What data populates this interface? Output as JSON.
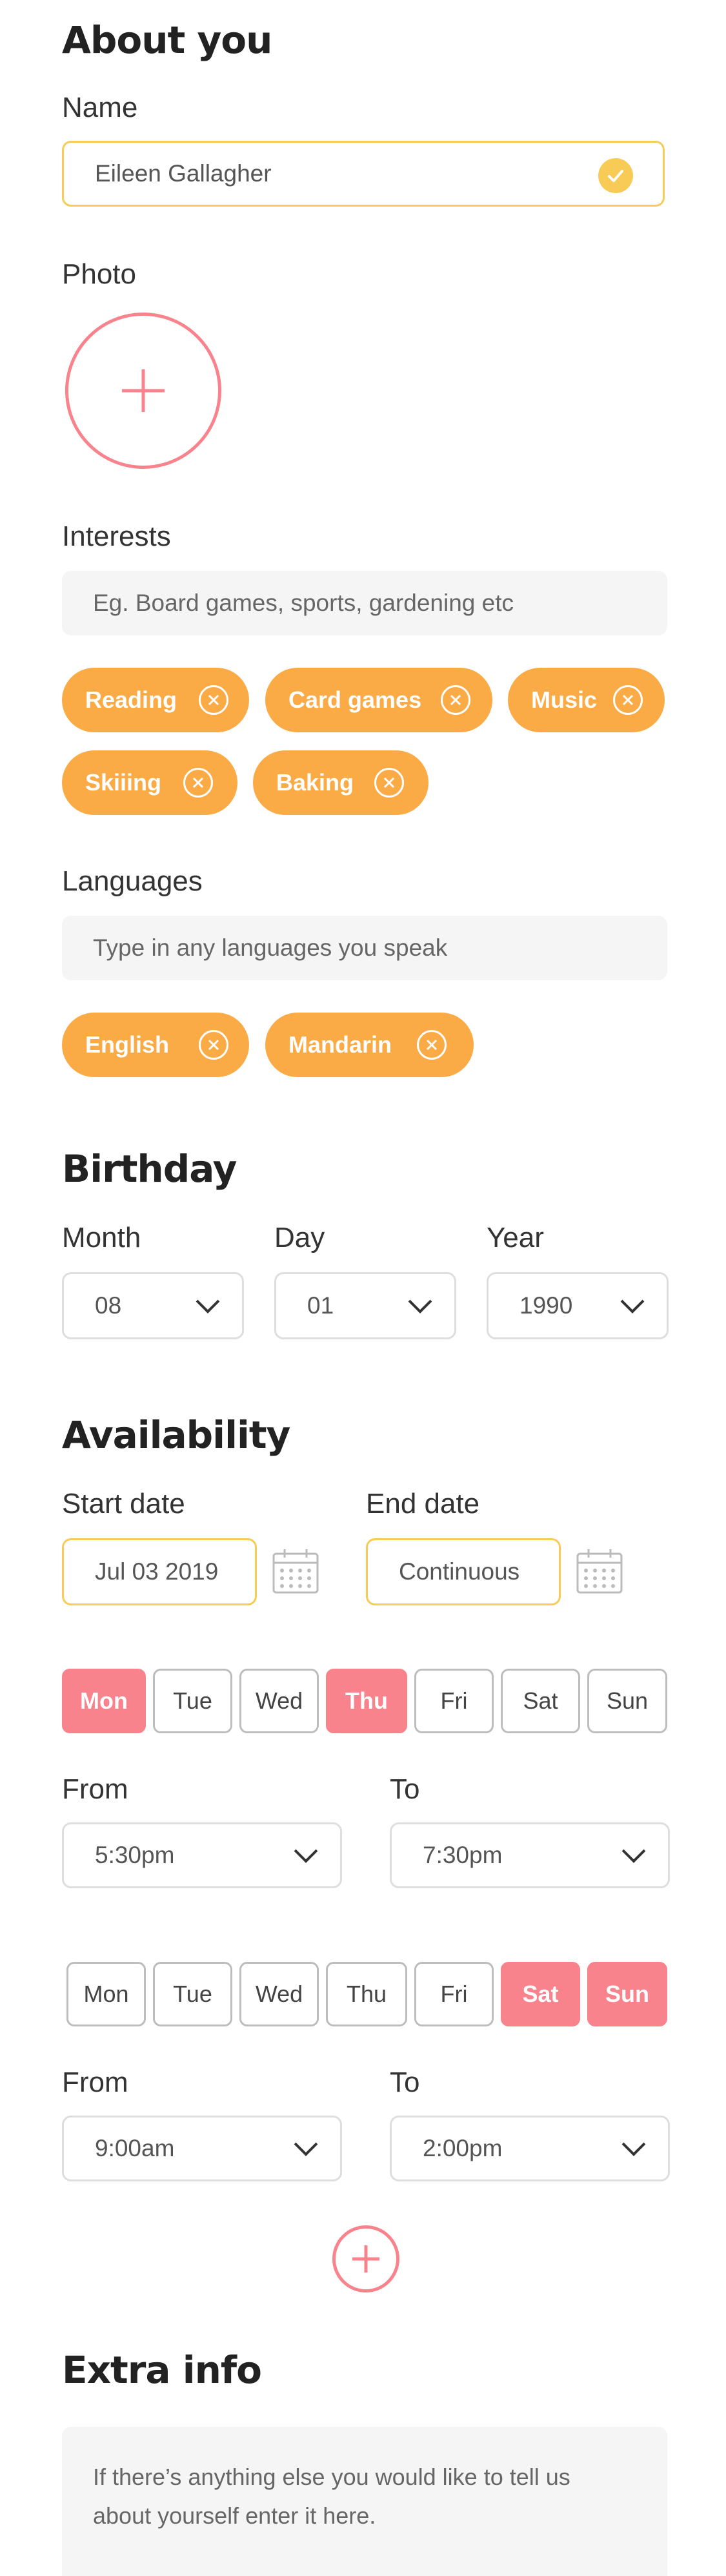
{
  "about": {
    "title": "About you",
    "name_label": "Name",
    "name_value": "Eileen Gallagher",
    "photo_label": "Photo",
    "interests_label": "Interests",
    "interests_placeholder": "Eg. Board games, sports, gardening etc",
    "interests": [
      "Reading",
      "Card games",
      "Music",
      "Skiiing",
      "Baking"
    ],
    "languages_label": "Languages",
    "languages_placeholder": "Type in any languages you speak",
    "languages": [
      "English",
      "Mandarin"
    ]
  },
  "birthday": {
    "title": "Birthday",
    "month_label": "Month",
    "month_value": "08",
    "day_label": "Day",
    "day_value": "01",
    "year_label": "Year",
    "year_value": "1990"
  },
  "availability": {
    "title": "Availability",
    "start_label": "Start date",
    "start_value": "Jul 03 2019",
    "end_label": "End date",
    "end_value": "Continuous",
    "slot1": {
      "days": [
        "Mon",
        "Tue",
        "Wed",
        "Thu",
        "Fri",
        "Sat",
        "Sun"
      ],
      "selected": [
        "Mon",
        "Thu"
      ],
      "from_label": "From",
      "from_value": "5:30pm",
      "to_label": "To",
      "to_value": "7:30pm"
    },
    "slot2": {
      "days": [
        "Mon",
        "Tue",
        "Wed",
        "Thu",
        "Fri",
        "Sat",
        "Sun"
      ],
      "selected": [
        "Sat",
        "Sun"
      ],
      "from_label": "From",
      "from_value": "9:00am",
      "to_label": "To",
      "to_value": "2:00pm"
    }
  },
  "extra": {
    "title": "Extra info",
    "placeholder": "If there’s anything else you would like to tell us about yourself enter it here."
  },
  "colors": {
    "accent_yellow": "#f7cb55",
    "chip_orange": "#fbab45",
    "pink": "#f8838d"
  },
  "icons": [
    "check-icon",
    "plus-icon",
    "close-icon",
    "chevron-down-icon",
    "calendar-icon"
  ]
}
